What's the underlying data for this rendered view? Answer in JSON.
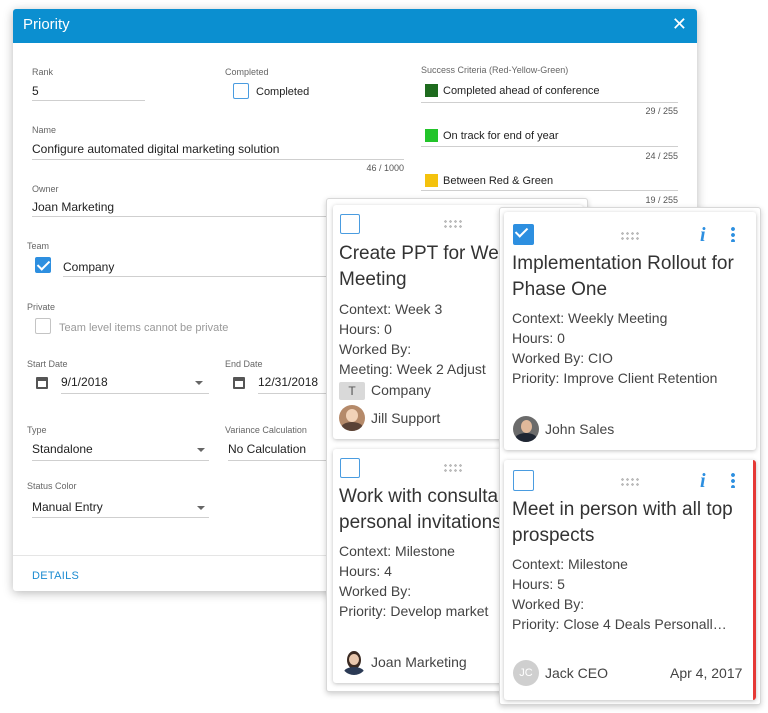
{
  "dialog": {
    "title": "Priority",
    "close_icon": "close-icon",
    "rank": {
      "label": "Rank",
      "value": "5"
    },
    "completed": {
      "label": "Completed",
      "checkbox_label": "Completed",
      "checked": false
    },
    "name": {
      "label": "Name",
      "value": "Configure automated digital marketing solution",
      "counter": "46 / 1000"
    },
    "owner": {
      "label": "Owner",
      "value": "Joan Marketing"
    },
    "team": {
      "label": "Team",
      "value": "Company",
      "checked": true
    },
    "private": {
      "label": "Private",
      "checkbox_label": "Team level items cannot be private",
      "disabled": true
    },
    "start_date": {
      "label": "Start Date",
      "value": "9/1/2018"
    },
    "end_date": {
      "label": "End Date",
      "value": "12/31/2018"
    },
    "type": {
      "label": "Type",
      "value": "Standalone"
    },
    "variance": {
      "label": "Variance Calculation",
      "value": "No Calculation"
    },
    "status_color": {
      "label": "Status Color",
      "value": "Manual Entry"
    },
    "success_criteria": {
      "label": "Success Criteria (Red-Yellow-Green)",
      "items": [
        {
          "color": "#1e6b1e",
          "text": "Completed ahead of conference",
          "counter": "29 / 255"
        },
        {
          "color": "#22c42a",
          "text": "On track for end of year",
          "counter": "24 / 255"
        },
        {
          "color": "#f4c20d",
          "text": "Between Red & Green",
          "counter": "19 / 255"
        }
      ]
    },
    "details_link": "DETAILS"
  },
  "cards_back": [
    {
      "title_1": "Create PPT for Wee",
      "title_2": "Meeting",
      "context": "Context: Week 3",
      "hours": "Hours: 0",
      "worked_by": "Worked By:",
      "meeting": "Meeting: Week 2 Adjust",
      "team_badge": "T",
      "team": "Company",
      "owner": "Jill Support",
      "checked": false
    },
    {
      "title_1": "Work with consulta",
      "title_2": "personal invitations",
      "context": "Context: Milestone",
      "hours": "Hours: 4",
      "worked_by": "Worked By:",
      "priority": "Priority: Develop market",
      "owner": "Joan Marketing",
      "checked": false
    }
  ],
  "cards_front": [
    {
      "title_1": "Implementation Rollout for",
      "title_2": "Phase One",
      "context": "Context: Weekly Meeting",
      "hours": "Hours: 0",
      "worked_by": "Worked By: CIO",
      "priority": "Priority: Improve Client Retention",
      "owner": "John Sales",
      "checked": true
    },
    {
      "title_1": "Meet in person with all top",
      "title_2": "prospects",
      "context": "Context: Milestone",
      "hours": "Hours: 5",
      "worked_by": "Worked By:",
      "priority": "Priority: Close 4 Deals Personall…",
      "owner_initials": "JC",
      "owner": "Jack CEO",
      "date": "Apr 4, 2017",
      "checked": false,
      "accent": "#e53935"
    }
  ]
}
